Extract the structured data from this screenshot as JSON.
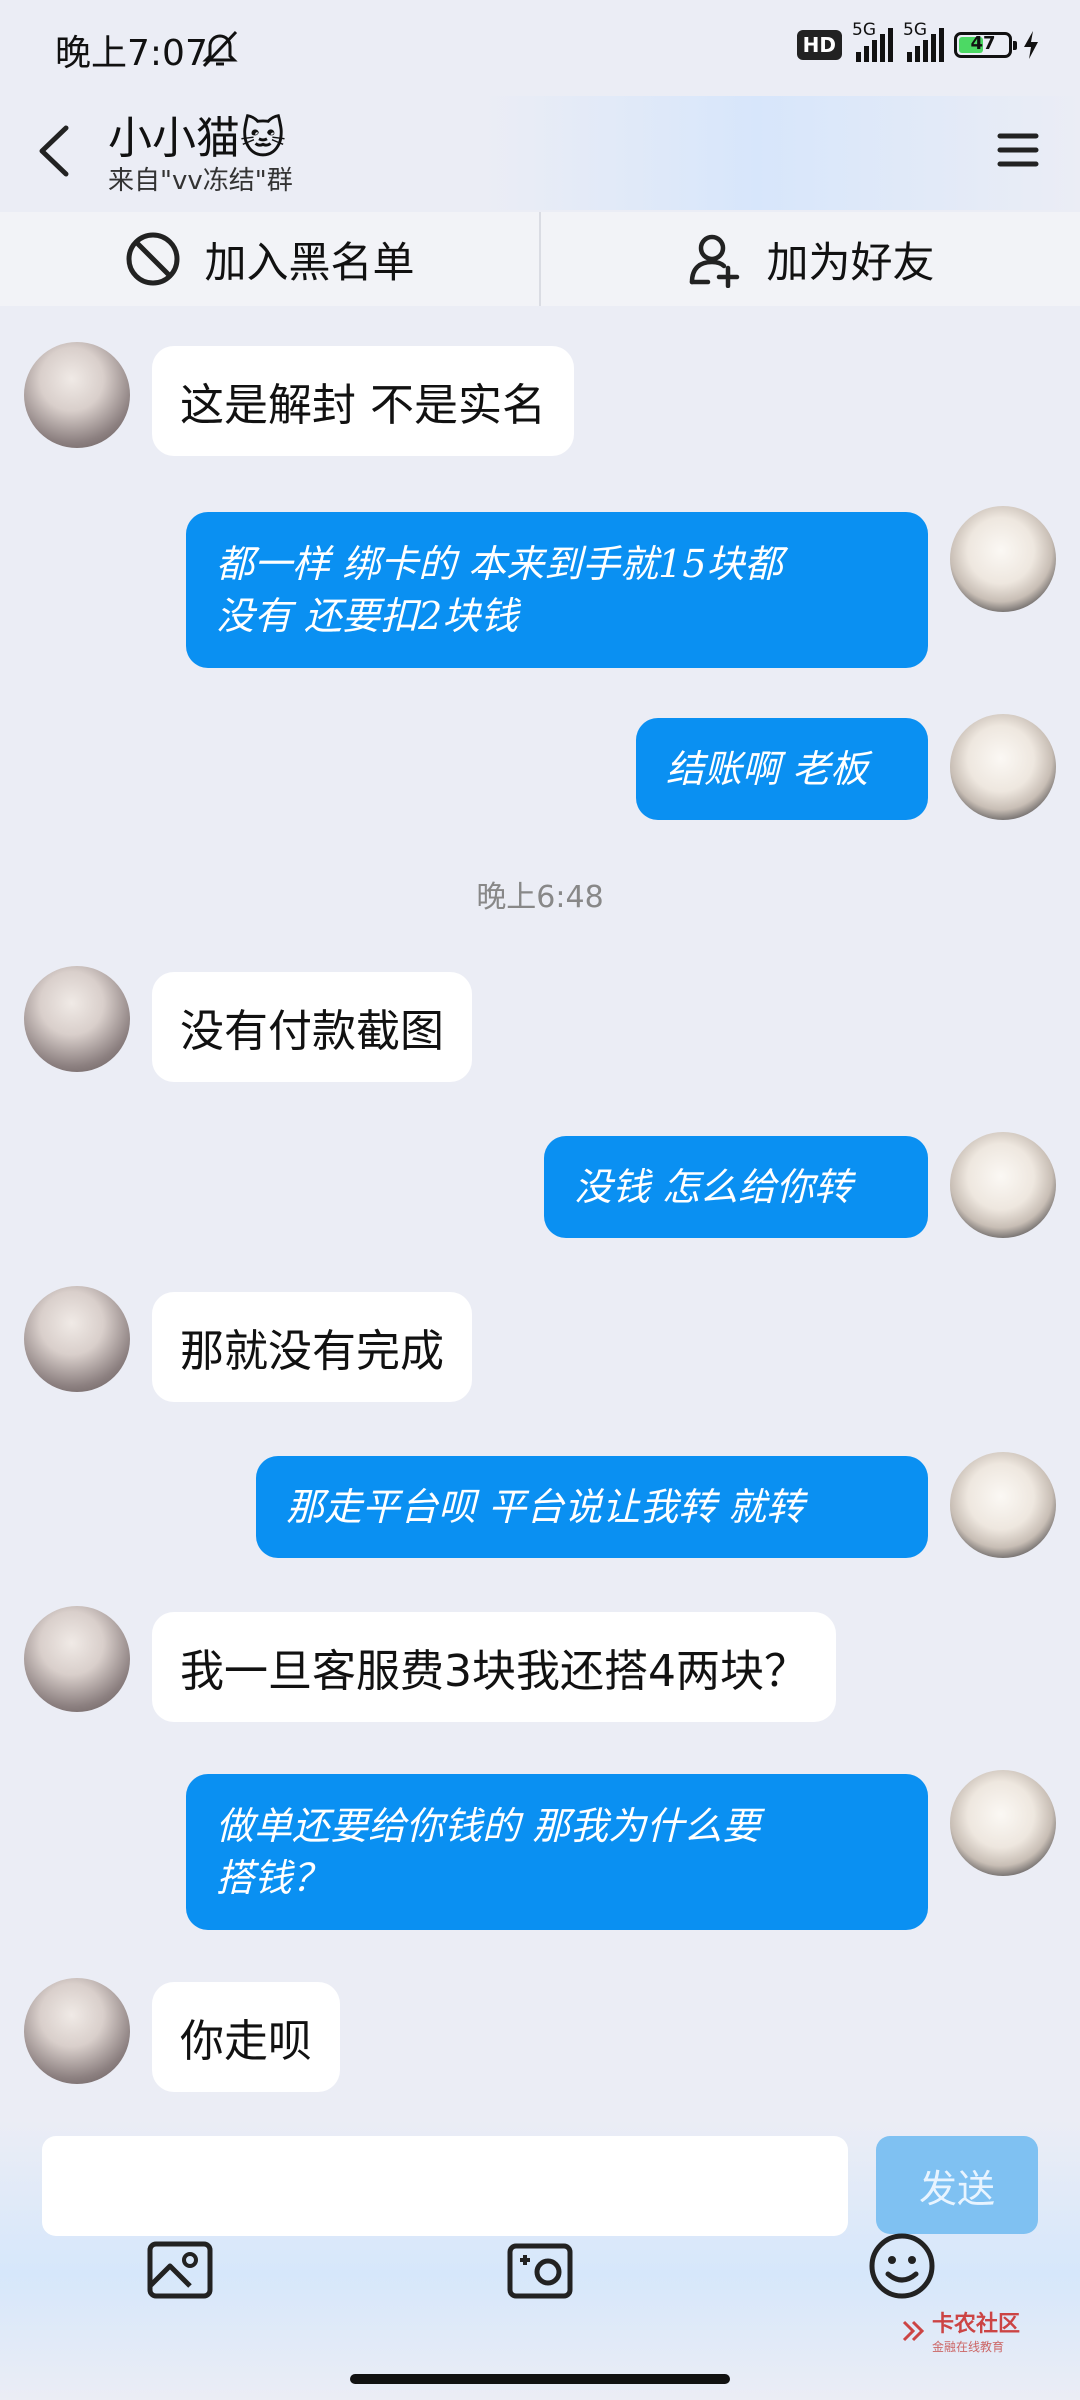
{
  "status": {
    "time": "晚上7:07",
    "hd": "HD",
    "sim1": "5G",
    "sim2": "5G",
    "battery": "47"
  },
  "header": {
    "title": "小小猫🐱",
    "subtitle": "来自\"vv冻结\"群"
  },
  "actions": {
    "block_label": "加入黑名单",
    "add_friend_label": "加为好友"
  },
  "messages": [
    {
      "side": "left",
      "text": "这是解封 不是实名"
    },
    {
      "side": "right",
      "lines": [
        "都一样 绑卡的 本来到手就15块都",
        "没有 还要扣2块钱"
      ]
    },
    {
      "side": "right",
      "lines": [
        "结账啊 老板"
      ]
    },
    {
      "side": "time",
      "text": "晚上6:48"
    },
    {
      "side": "left",
      "text": "没有付款截图"
    },
    {
      "side": "right",
      "lines": [
        "没钱 怎么给你转"
      ]
    },
    {
      "side": "left",
      "text": "那就没有完成"
    },
    {
      "side": "right",
      "lines": [
        "那走平台呗 平台说让我转 就转"
      ]
    },
    {
      "side": "left",
      "text": "我一旦客服费3块我还搭4两块？"
    },
    {
      "side": "right",
      "lines": [
        "做单还要给你钱的 那我为什么要",
        "搭钱？"
      ]
    },
    {
      "side": "left",
      "text": "你走呗"
    }
  ],
  "composer": {
    "send_label": "发送",
    "input_value": ""
  },
  "watermark": {
    "name": "卡农社区",
    "tagline": "金融在线教育"
  }
}
